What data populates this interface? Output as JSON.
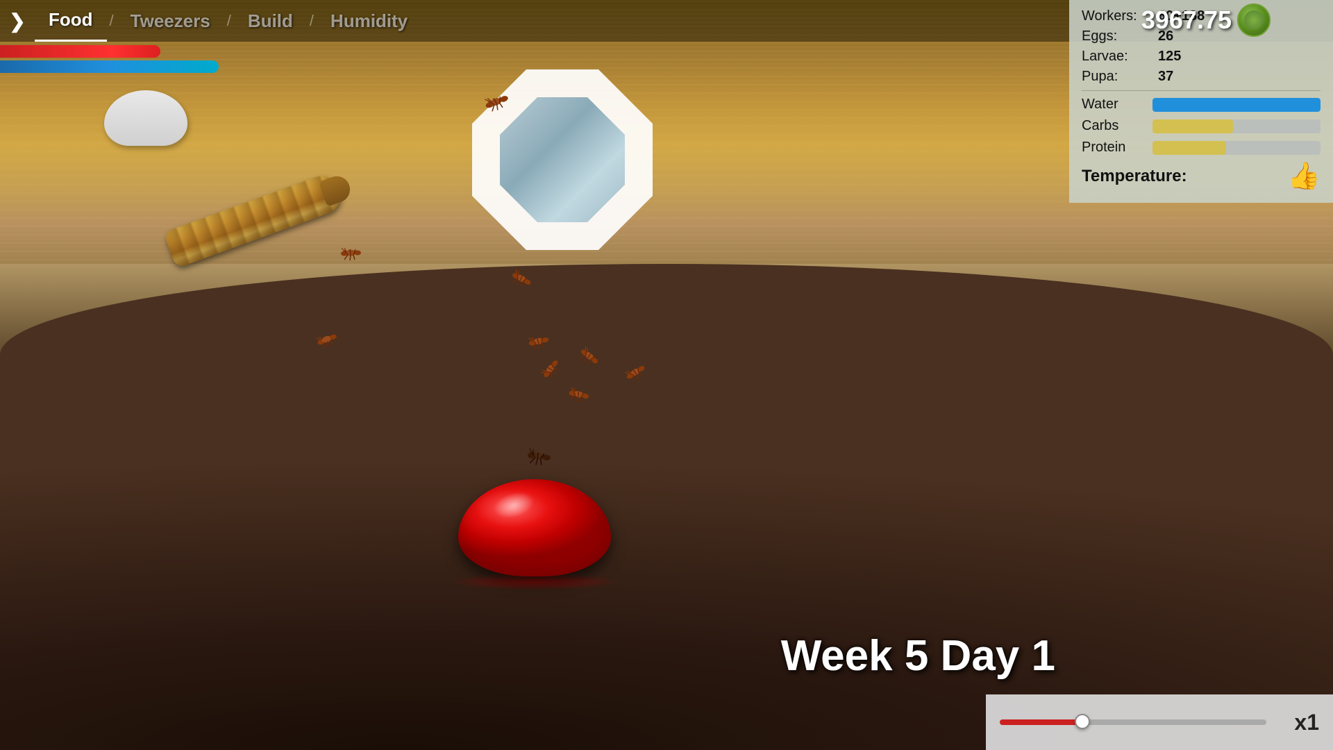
{
  "nav": {
    "arrow_label": "❯",
    "items": [
      {
        "label": "Food",
        "state": "active"
      },
      {
        "label": "Tweezers",
        "state": "inactive"
      },
      {
        "label": "Build",
        "state": "inactive"
      },
      {
        "label": "Humidity",
        "state": "inactive"
      }
    ]
  },
  "currency": {
    "amount": "3967.75",
    "icon_label": "BB"
  },
  "stats": {
    "workers_label": "Workers:",
    "workers_value": "60+188",
    "eggs_label": "Eggs:",
    "eggs_value": "26",
    "larvae_label": "Larvae:",
    "larvae_value": "125",
    "pupa_label": "Pupa:",
    "pupa_value": "37",
    "water_label": "Water",
    "carbs_label": "Carbs",
    "protein_label": "Protein",
    "temperature_label": "Temperature:",
    "temperature_icon": "thumbs-up"
  },
  "time": {
    "week": "Week 5 Day 1"
  },
  "speed": {
    "multiplier": "x1"
  },
  "bars": {
    "water_pct": 100,
    "carbs_pct": 48,
    "protein_pct": 44
  }
}
